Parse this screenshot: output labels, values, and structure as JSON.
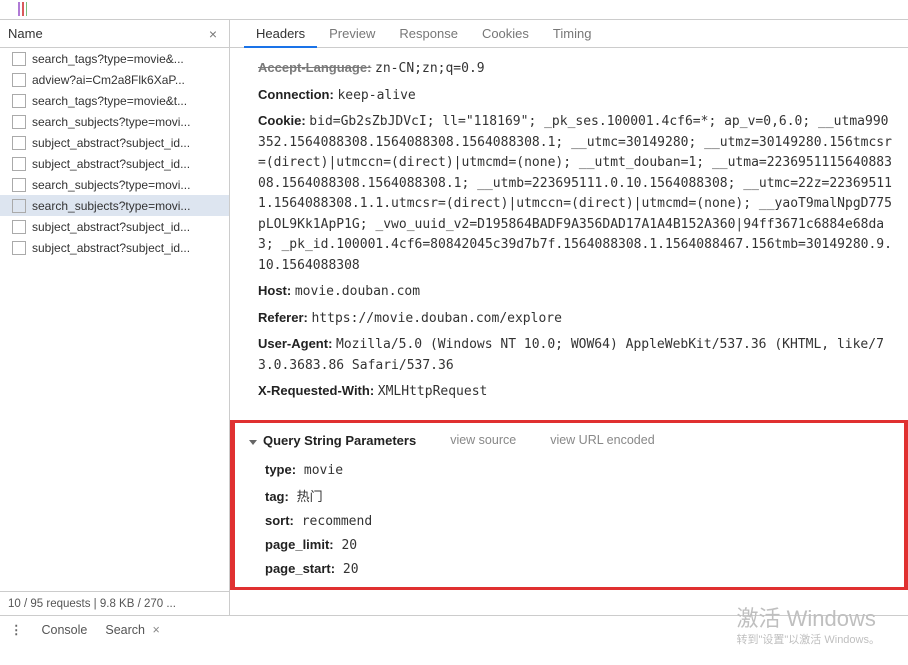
{
  "sidebar": {
    "header": "Name",
    "close_glyph": "×",
    "items": [
      {
        "label": "search_tags?type=movie&..."
      },
      {
        "label": "adview?ai=Cm2a8Flk6XaP..."
      },
      {
        "label": "search_tags?type=movie&t..."
      },
      {
        "label": "search_subjects?type=movi..."
      },
      {
        "label": "subject_abstract?subject_id..."
      },
      {
        "label": "subject_abstract?subject_id..."
      },
      {
        "label": "search_subjects?type=movi..."
      },
      {
        "label": "search_subjects?type=movi...",
        "selected": true
      },
      {
        "label": "subject_abstract?subject_id..."
      },
      {
        "label": "subject_abstract?subject_id..."
      }
    ],
    "status": "10 / 95 requests  |  9.8 KB / 270 ..."
  },
  "tabs": {
    "items": [
      {
        "label": "Headers",
        "active": true
      },
      {
        "label": "Preview"
      },
      {
        "label": "Response"
      },
      {
        "label": "Cookies"
      },
      {
        "label": "Timing"
      }
    ]
  },
  "headers": {
    "accept_language": {
      "k": "Accept-Language:",
      "v": "zn-CN;zn;q=0.9"
    },
    "connection": {
      "k": "Connection:",
      "v": "keep-alive"
    },
    "cookie": {
      "k": "Cookie:",
      "v": "bid=Gb2sZbJDVcI; ll=\"118169\"; _pk_ses.100001.4cf6=*; ap_v=0,6.0; __utma990352.1564088308.1564088308.1564088308.1; __utmc=30149280; __utmz=30149280.156tmcsr=(direct)|utmccn=(direct)|utmcmd=(none); __utmt_douban=1; __utma=223695111564088308.1564088308.1564088308.1; __utmb=223695111.0.10.1564088308; __utmc=22z=223695111.1564088308.1.1.utmcsr=(direct)|utmccn=(direct)|utmcmd=(none); __yaoT9malNpgD775pLOL9Kk1ApP1G; _vwo_uuid_v2=D195864BADF9A356DAD17A1A4B152A360|94ff3671c6884e68da3; _pk_id.100001.4cf6=80842045c39d7b7f.1564088308.1.1564088467.156tmb=30149280.9.10.1564088308"
    },
    "host": {
      "k": "Host:",
      "v": "movie.douban.com"
    },
    "referer": {
      "k": "Referer:",
      "v": "https://movie.douban.com/explore"
    },
    "user_agent": {
      "k": "User-Agent:",
      "v": "Mozilla/5.0 (Windows NT 10.0; WOW64) AppleWebKit/537.36 (KHTML, like/73.0.3683.86 Safari/537.36"
    },
    "x_requested_with": {
      "k": "X-Requested-With:",
      "v": "XMLHttpRequest"
    }
  },
  "query_section": {
    "title": "Query String Parameters",
    "view_source": "view source",
    "view_url_encoded": "view URL encoded",
    "params": [
      {
        "k": "type:",
        "v": "movie"
      },
      {
        "k": "tag:",
        "v": "热门"
      },
      {
        "k": "sort:",
        "v": "recommend"
      },
      {
        "k": "page_limit:",
        "v": "20"
      },
      {
        "k": "page_start:",
        "v": "20"
      }
    ]
  },
  "bottom": {
    "console": "Console",
    "search": "Search",
    "search_close": "×"
  },
  "watermark": {
    "l1": "激活 Windows",
    "l2": "转到\"设置\"以激活 Windows。"
  }
}
